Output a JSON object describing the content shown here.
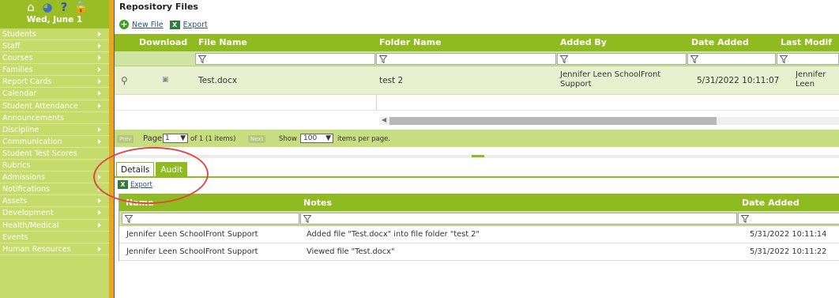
{
  "sidebar": {
    "icons": [
      "home-icon",
      "globe-icon",
      "help-icon",
      "lock-icon"
    ],
    "date": "Wed, June 1",
    "items": [
      {
        "label": "Students",
        "arrow": true
      },
      {
        "label": "Staff",
        "arrow": true
      },
      {
        "label": "Courses",
        "arrow": true
      },
      {
        "label": "Families",
        "arrow": true
      },
      {
        "label": "Report Cards",
        "arrow": true
      },
      {
        "label": "Calendar",
        "arrow": true
      },
      {
        "label": "Student Attendance",
        "arrow": true
      },
      {
        "label": "Announcements",
        "arrow": false
      },
      {
        "label": "Discipline",
        "arrow": true
      },
      {
        "label": "Communication",
        "arrow": true
      },
      {
        "label": "Student Test Scores",
        "arrow": false
      },
      {
        "label": "Rubrics",
        "arrow": false
      },
      {
        "label": "Admissions",
        "arrow": true
      },
      {
        "label": "Notifications",
        "arrow": true
      },
      {
        "label": "Assets",
        "arrow": true
      },
      {
        "label": "Development",
        "arrow": true
      },
      {
        "label": "Health/Medical",
        "arrow": true
      },
      {
        "label": "Events",
        "arrow": false
      },
      {
        "label": "Human Resources",
        "arrow": true
      }
    ]
  },
  "repo": {
    "title": "Repository Files",
    "new_file": "New File",
    "export": "Export",
    "columns": [
      "Download",
      "File Name",
      "Folder Name",
      "Added By",
      "Date Added",
      "Last Modif"
    ],
    "row": {
      "file_name": "Test.docx",
      "folder_name": "test 2",
      "added_by": "Jennifer Leen SchoolFront Support",
      "date_added": "5/31/2022 10:11:07",
      "last_modified": "Jennifer Leen SchoolFront Support"
    },
    "pager": {
      "prev": "Prev",
      "page_label": "Page",
      "page_value": "1",
      "of_text": "of 1 (1 items)",
      "next": "Next",
      "show_label": "Show",
      "show_value": "100",
      "per_page": "items per page."
    }
  },
  "detail_tabs": {
    "details": "Details",
    "audit": "Audit"
  },
  "audit": {
    "export": "Export",
    "columns": [
      "Name",
      "Notes",
      "Date Added"
    ],
    "rows": [
      {
        "name": "Jennifer Leen SchoolFront Support",
        "notes": "Added file \"Test.docx\" into file folder \"test 2\"",
        "date": "5/31/2022 10:11:14"
      },
      {
        "name": "Jennifer Leen SchoolFront Support",
        "notes": "Viewed file \"Test.docx\"",
        "date": "5/31/2022 10:11:22"
      }
    ]
  },
  "colors": {
    "sidebar_bg": "#c5dc6a",
    "header_green": "#8fba20",
    "accent_orange": "#e8a722",
    "annotation_red": "#e04848"
  }
}
